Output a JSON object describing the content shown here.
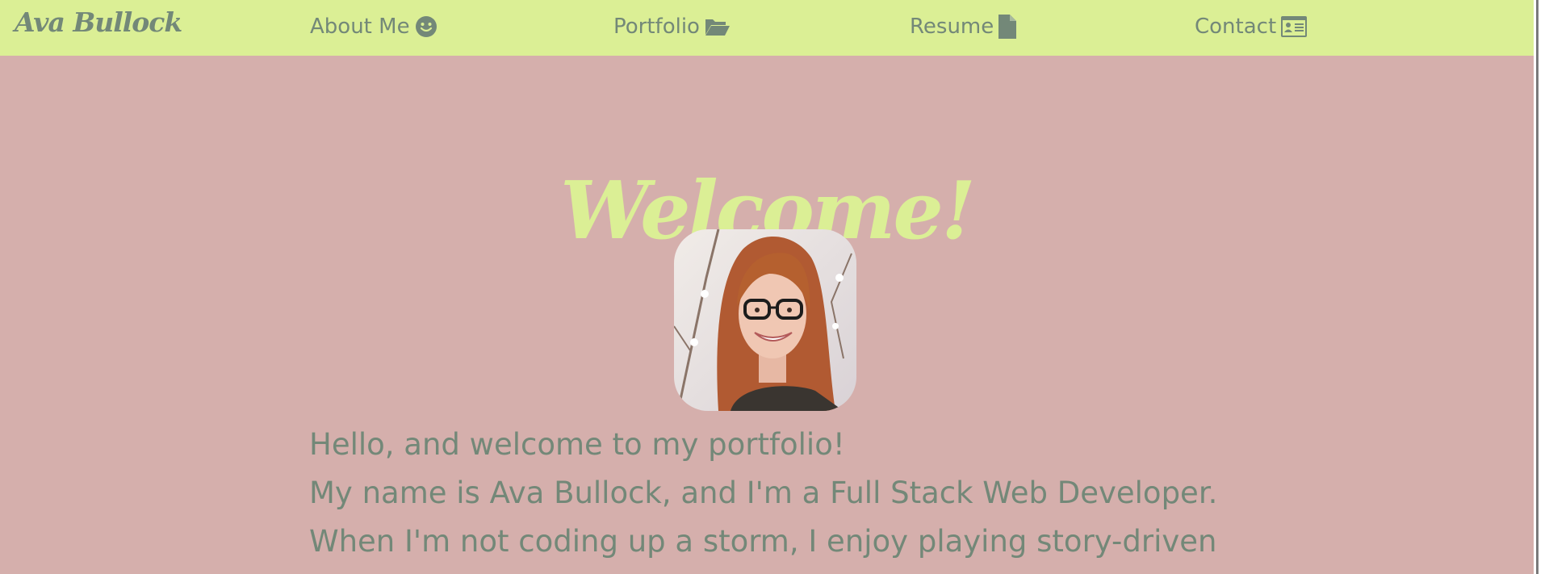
{
  "navbar": {
    "brand": "Ava Bullock",
    "items": [
      {
        "label": "About Me",
        "icon": "smile-icon"
      },
      {
        "label": "Portfolio",
        "icon": "folder-open-icon"
      },
      {
        "label": "Resume",
        "icon": "file-icon"
      },
      {
        "label": "Contact",
        "icon": "id-card-icon"
      }
    ]
  },
  "hero": {
    "title": "Welcome!",
    "avatar_alt": "Portrait photo of Ava Bullock"
  },
  "bio": {
    "lines": [
      "Hello, and welcome to my portfolio!",
      "My name is Ava Bullock, and I'm a Full Stack Web Developer.",
      "When I'm not coding up a storm, I enjoy playing story-driven"
    ]
  },
  "colors": {
    "navbar_bg": "#dbef95",
    "page_bg": "#d5afac",
    "text": "#738878",
    "accent": "#dbef95"
  }
}
